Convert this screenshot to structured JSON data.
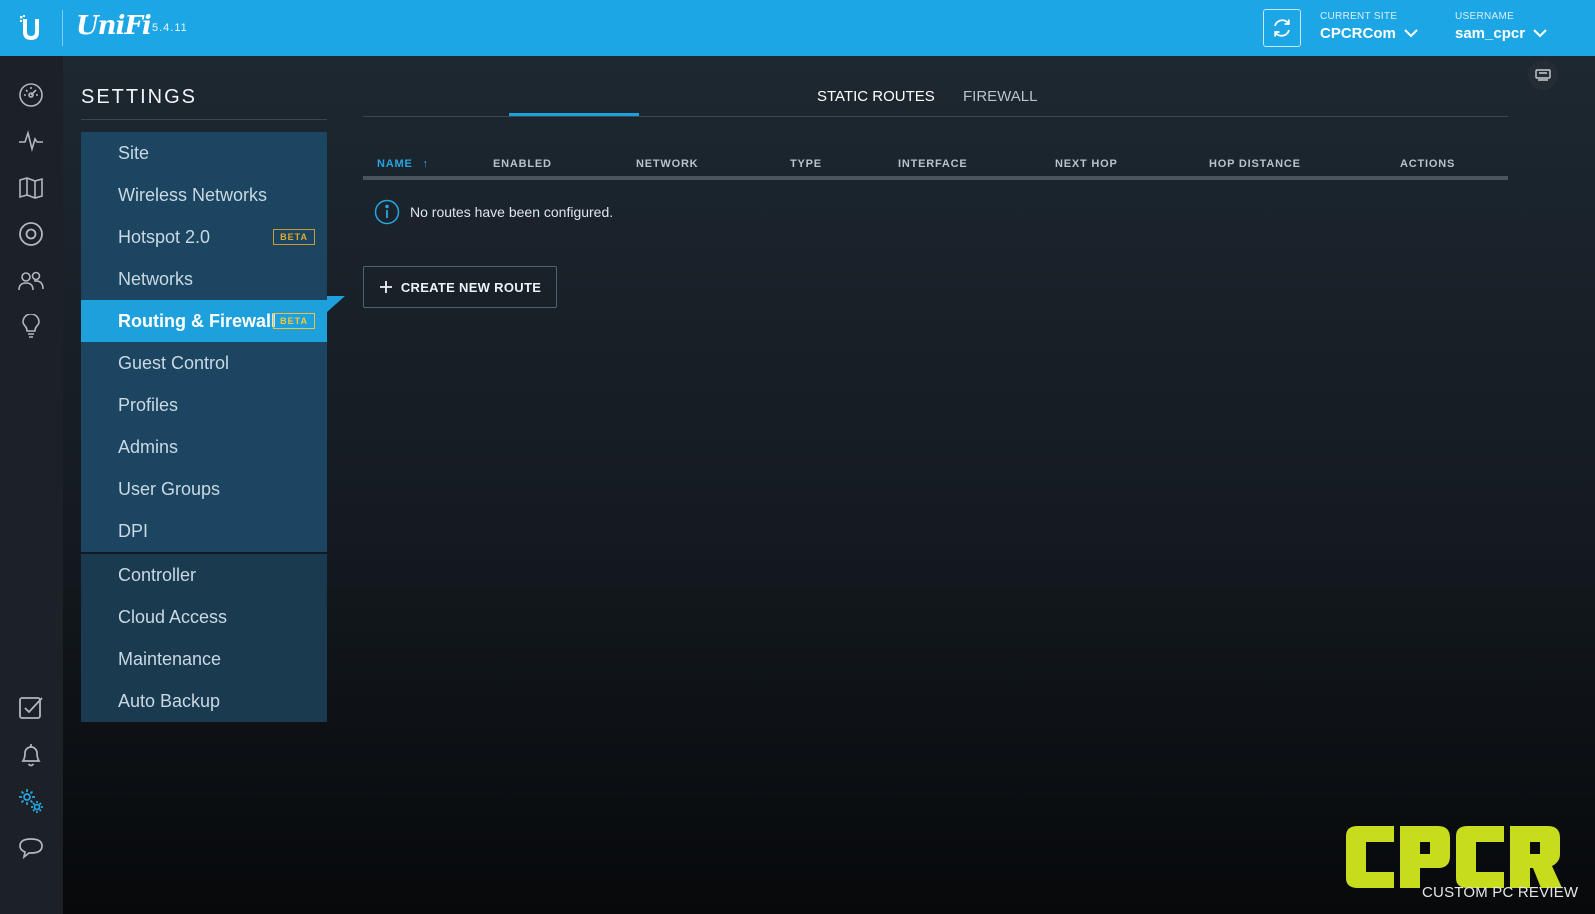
{
  "app": {
    "name": "UniFi",
    "version": "5.4.11",
    "brand_color": "#1da6e6"
  },
  "topbar": {
    "current_site_label": "CURRENT SITE",
    "current_site_value": "CPCRCom",
    "username_label": "USERNAME",
    "username_value": "sam_cpcr"
  },
  "rail": {
    "icons": [
      "dashboard-icon",
      "statistics-icon",
      "map-icon",
      "devices-icon",
      "clients-icon",
      "insights-icon",
      "events-icon",
      "alerts-icon",
      "settings-icon",
      "chat-icon"
    ]
  },
  "settings": {
    "title": "SETTINGS",
    "menu_group1": [
      {
        "label": "Site"
      },
      {
        "label": "Wireless Networks"
      },
      {
        "label": "Hotspot 2.0",
        "badge": "BETA"
      },
      {
        "label": "Networks"
      },
      {
        "label": "Routing & Firewall",
        "badge": "BETA",
        "active": true
      },
      {
        "label": "Guest Control"
      },
      {
        "label": "Profiles"
      },
      {
        "label": "Admins"
      },
      {
        "label": "User Groups"
      },
      {
        "label": "DPI"
      }
    ],
    "menu_group2": [
      {
        "label": "Controller"
      },
      {
        "label": "Cloud Access"
      },
      {
        "label": "Maintenance"
      },
      {
        "label": "Auto Backup"
      }
    ]
  },
  "tabs": [
    {
      "label": "STATIC ROUTES",
      "active": true
    },
    {
      "label": "FIREWALL",
      "active": false
    }
  ],
  "table": {
    "columns": [
      "NAME",
      "ENABLED",
      "NETWORK",
      "TYPE",
      "INTERFACE",
      "NEXT HOP",
      "HOP DISTANCE",
      "ACTIONS"
    ],
    "sort_indicator": "↑",
    "empty_message": "No routes have been configured."
  },
  "create_button": "CREATE NEW ROUTE",
  "watermark": {
    "logo": "CPCR",
    "subtitle": "CUSTOM PC REVIEW",
    "color": "#c8dc1e"
  }
}
